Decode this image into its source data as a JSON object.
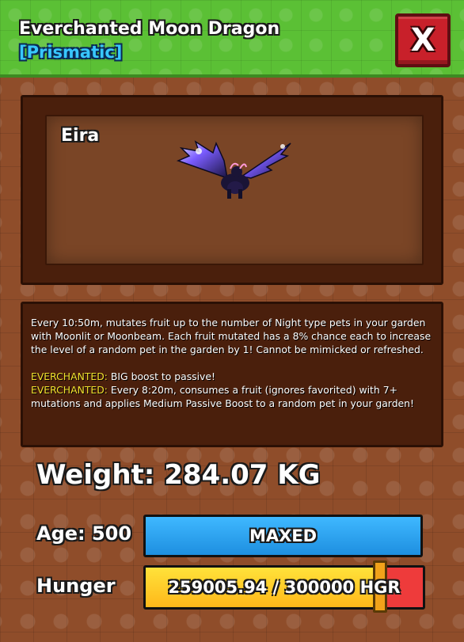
{
  "header": {
    "title": "Everchanted Moon Dragon",
    "subtitle": "[Prismatic]",
    "close_label": "X",
    "bg_color": "#5bc035",
    "subtitle_color": "#38c7ff",
    "close_color": "#c8202a"
  },
  "pet": {
    "name": "Eira",
    "icon": "moon-dragon-sprite"
  },
  "description": {
    "line1": "Every 10:50m, mutates fruit up to the number of Night type pets in your garden with Moonlit or Moonbeam. Each fruit mutated has a 8% chance each to increase the level of a random pet in the garden by 1! Cannot be mimicked or refreshed.",
    "ev1_label": "EVERCHANTED:",
    "ev1_text": " BIG boost to passive!",
    "ev2_label": "EVERCHANTED:",
    "ev2_text": " Every 8:20m, consumes a fruit (ignores favorited) with 7+ mutations and applies Medium Passive Boost to a random pet in your garden!"
  },
  "stats": {
    "weight": "Weight: 284.07 KG",
    "age_label": "Age: 500",
    "age_bar_text": "MAXED",
    "age_color": "#3fb8ff",
    "hunger_label": "Hunger",
    "hunger_bar_text": "259005.94 / 300000 HGR",
    "hunger_current": 259005.94,
    "hunger_max": 300000,
    "hunger_color": "#ffd42a"
  }
}
